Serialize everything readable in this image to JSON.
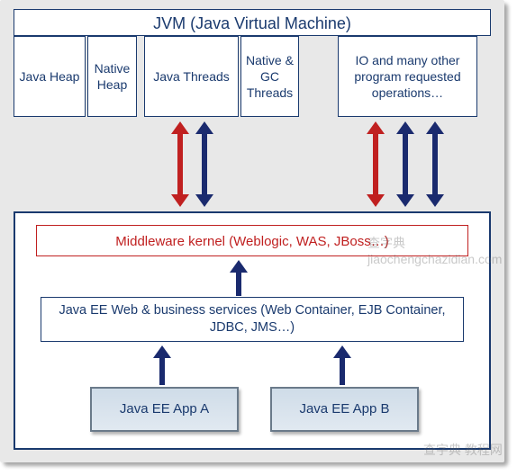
{
  "jvm_title": "JVM (Java Virtual Machine)",
  "top": {
    "heap": "Java Heap",
    "native": "Native Heap",
    "threads": "Java Threads",
    "gc": "Native & GC Threads",
    "io": "IO and many other program requested operations…"
  },
  "middleware": "Middleware kernel (Weblogic, WAS, JBoss…)",
  "services": "Java EE Web & business services (Web Container, EJB Container, JDBC, JMS…)",
  "apps": {
    "a": "Java EE App A",
    "b": "Java EE App B"
  },
  "watermarks": {
    "w1": "查字典 jiaochengchazidian.com",
    "w2": "查字典 教程网"
  },
  "chart_data": {
    "type": "diagram",
    "layers": [
      {
        "id": "jvm",
        "label": "JVM (Java Virtual Machine)",
        "children": [
          "java_heap",
          "native_heap",
          "java_threads",
          "native_gc_threads",
          "io_ops"
        ]
      },
      {
        "id": "java_heap",
        "label": "Java Heap"
      },
      {
        "id": "native_heap",
        "label": "Native Heap"
      },
      {
        "id": "java_threads",
        "label": "Java Threads"
      },
      {
        "id": "native_gc_threads",
        "label": "Native & GC Threads"
      },
      {
        "id": "io_ops",
        "label": "IO and many other program requested operations…"
      },
      {
        "id": "mw_kernel",
        "label": "Middleware kernel (Weblogic, WAS, JBoss…)"
      },
      {
        "id": "ee_services",
        "label": "Java EE Web & business services (Web Container, EJB Container, JDBC, JMS…)"
      },
      {
        "id": "app_a",
        "label": "Java EE App A"
      },
      {
        "id": "app_b",
        "label": "Java EE App B"
      }
    ],
    "edges": [
      {
        "from": "java_threads",
        "to": "mw_kernel",
        "style": "red-double"
      },
      {
        "from": "java_threads",
        "to": "mw_kernel",
        "style": "blue-double"
      },
      {
        "from": "io_ops",
        "to": "mw_kernel",
        "style": "red-double"
      },
      {
        "from": "io_ops",
        "to": "mw_kernel",
        "style": "blue-double"
      },
      {
        "from": "io_ops",
        "to": "mw_kernel",
        "style": "blue-double"
      },
      {
        "from": "ee_services",
        "to": "mw_kernel",
        "style": "blue-up"
      },
      {
        "from": "app_a",
        "to": "ee_services",
        "style": "blue-up"
      },
      {
        "from": "app_b",
        "to": "ee_services",
        "style": "blue-up"
      }
    ]
  }
}
